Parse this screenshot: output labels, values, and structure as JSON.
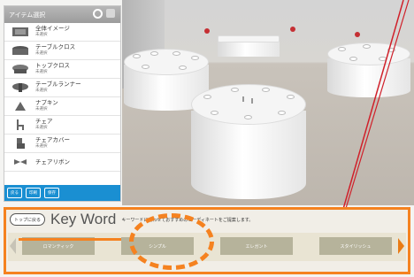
{
  "sidebar": {
    "title": "アイテム選択",
    "items": [
      {
        "label": "全体イメージ",
        "sub": "未選択"
      },
      {
        "label": "テーブルクロス",
        "sub": "未選択"
      },
      {
        "label": "トップクロス",
        "sub": "未選択"
      },
      {
        "label": "テーブルランナー",
        "sub": "未選択"
      },
      {
        "label": "ナプキン",
        "sub": "未選択"
      },
      {
        "label": "チェア",
        "sub": "未選択"
      },
      {
        "label": "チェアカバー",
        "sub": "未選択"
      },
      {
        "label": "チェアリボン",
        "sub": ""
      }
    ],
    "buttons": [
      "戻る",
      "印刷",
      "保存"
    ]
  },
  "keyword": {
    "top_button": "トップに戻る",
    "title": "Key Word",
    "description": "キーワードに合わせておすすめのコーディネートをご提案します。",
    "cards": [
      "ロマンティック",
      "シンプル",
      "エレガント",
      "スタイリッシュ"
    ]
  },
  "colors": {
    "accent_orange": "#f58220",
    "selection_blue": "#1a8fd2",
    "pointer_red": "#d0202a"
  }
}
